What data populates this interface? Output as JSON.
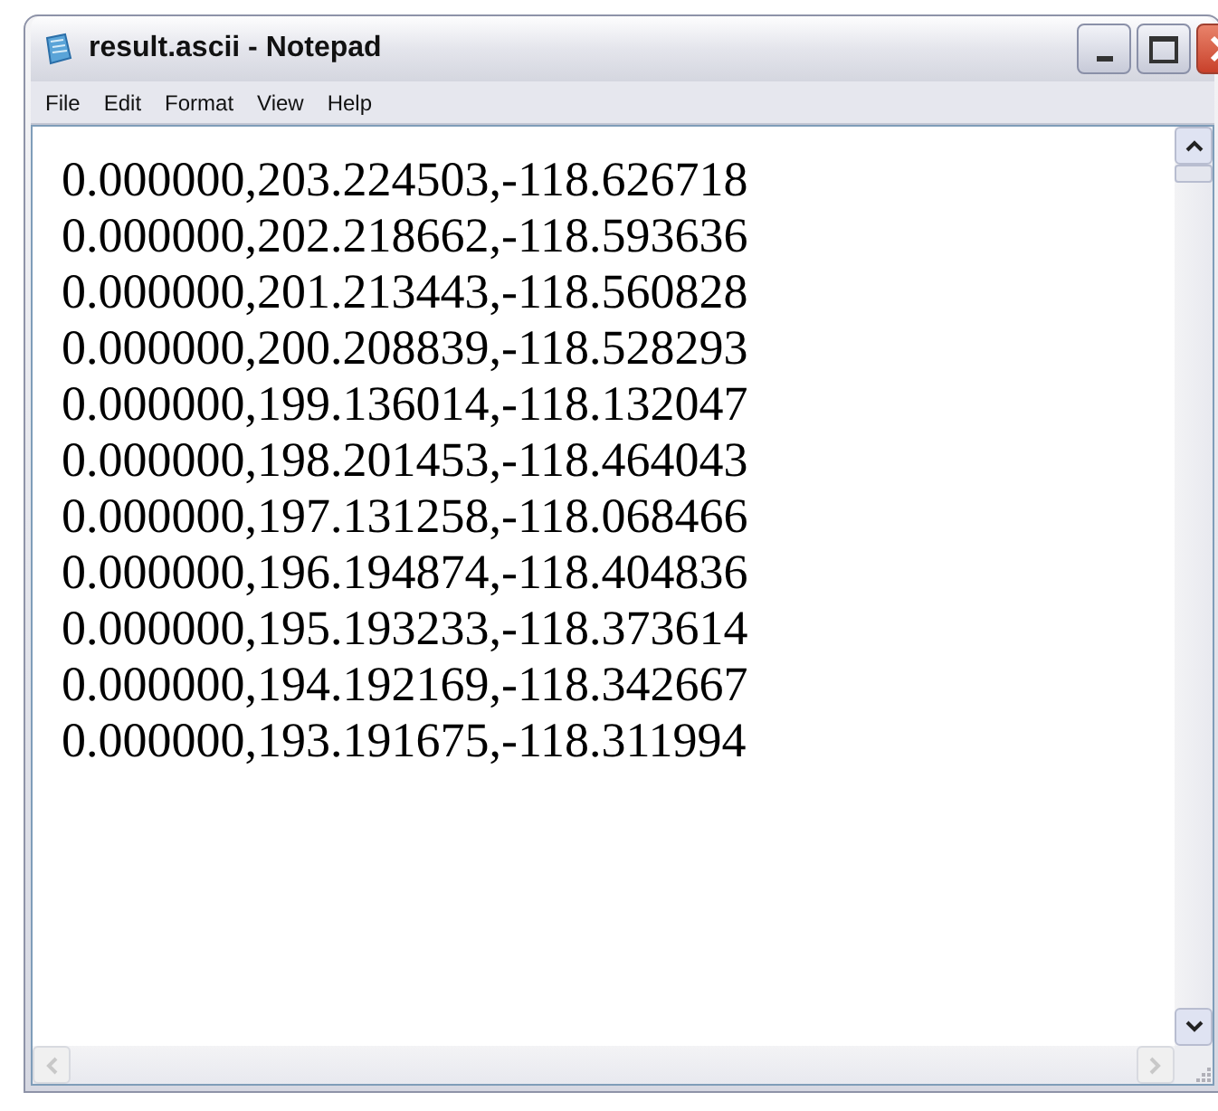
{
  "window": {
    "title": "result.ascii - Notepad"
  },
  "menu": [
    "File",
    "Edit",
    "Format",
    "View",
    "Help"
  ],
  "lines": [
    "0.000000,203.224503,-118.626718",
    "0.000000,202.218662,-118.593636",
    "0.000000,201.213443,-118.560828",
    "0.000000,200.208839,-118.528293",
    "0.000000,199.136014,-118.132047",
    "0.000000,198.201453,-118.464043",
    "0.000000,197.131258,-118.068466",
    "0.000000,196.194874,-118.404836",
    "0.000000,195.193233,-118.373614",
    "0.000000,194.192169,-118.342667",
    "0.000000,193.191675,-118.311994"
  ]
}
